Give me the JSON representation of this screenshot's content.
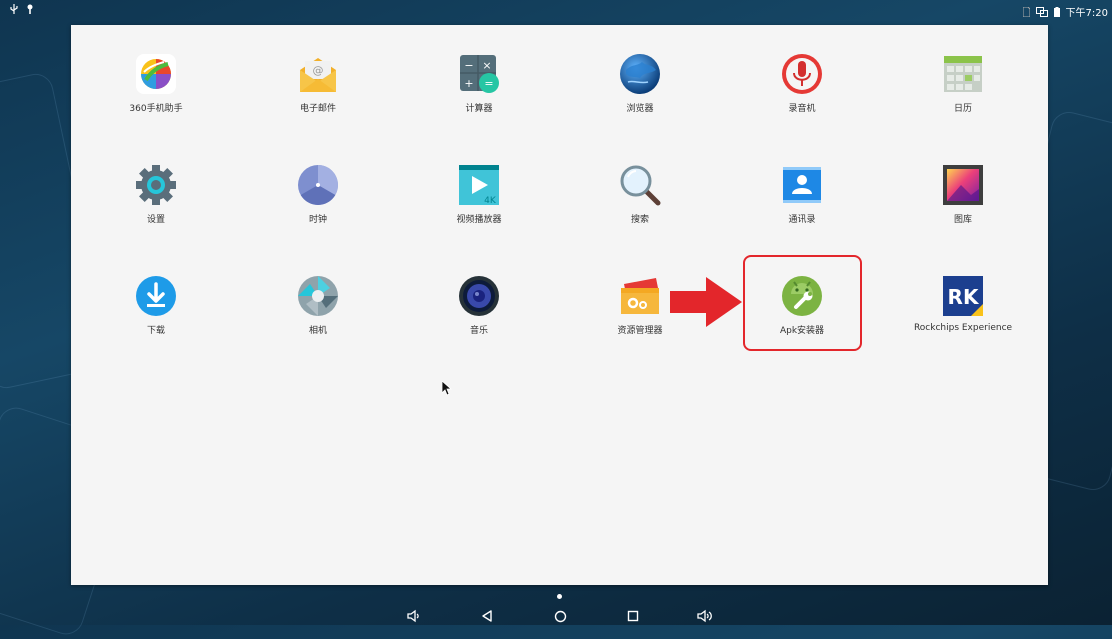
{
  "status_bar": {
    "time": "下午7:20"
  },
  "apps": [
    {
      "id": "app-360",
      "label": "360手机助手",
      "icon": "360-icon"
    },
    {
      "id": "app-email",
      "label": "电子邮件",
      "icon": "email-icon"
    },
    {
      "id": "app-calculator",
      "label": "计算器",
      "icon": "calculator-icon"
    },
    {
      "id": "app-browser",
      "label": "浏览器",
      "icon": "globe-icon"
    },
    {
      "id": "app-recorder",
      "label": "录音机",
      "icon": "microphone-icon"
    },
    {
      "id": "app-calendar",
      "label": "日历",
      "icon": "calendar-icon"
    },
    {
      "id": "app-settings",
      "label": "设置",
      "icon": "gear-icon"
    },
    {
      "id": "app-clock",
      "label": "时钟",
      "icon": "clock-icon"
    },
    {
      "id": "app-video",
      "label": "视频播放器",
      "icon": "video-player-icon"
    },
    {
      "id": "app-search",
      "label": "搜索",
      "icon": "magnifier-icon"
    },
    {
      "id": "app-contacts",
      "label": "通讯录",
      "icon": "contacts-icon"
    },
    {
      "id": "app-gallery",
      "label": "图库",
      "icon": "gallery-icon"
    },
    {
      "id": "app-download",
      "label": "下载",
      "icon": "download-icon"
    },
    {
      "id": "app-camera",
      "label": "相机",
      "icon": "camera-icon"
    },
    {
      "id": "app-music",
      "label": "音乐",
      "icon": "speaker-icon"
    },
    {
      "id": "app-files",
      "label": "资源管理器",
      "icon": "folder-icon"
    },
    {
      "id": "app-apk",
      "label": "Apk安装器",
      "icon": "android-icon"
    },
    {
      "id": "app-rk",
      "label": "Rockchips Experience",
      "icon": "rk-logo-icon"
    }
  ],
  "rk_logo_text": "RK",
  "calculator_glyphs": {
    "minus": "−",
    "times": "×",
    "plus": "+",
    "equals": "="
  },
  "video_badge": "4K",
  "email_glyph": "@",
  "colors": {
    "highlight": "#e3262b",
    "drawer_bg": "#f5f5f5",
    "wallpaper": "#164766"
  }
}
